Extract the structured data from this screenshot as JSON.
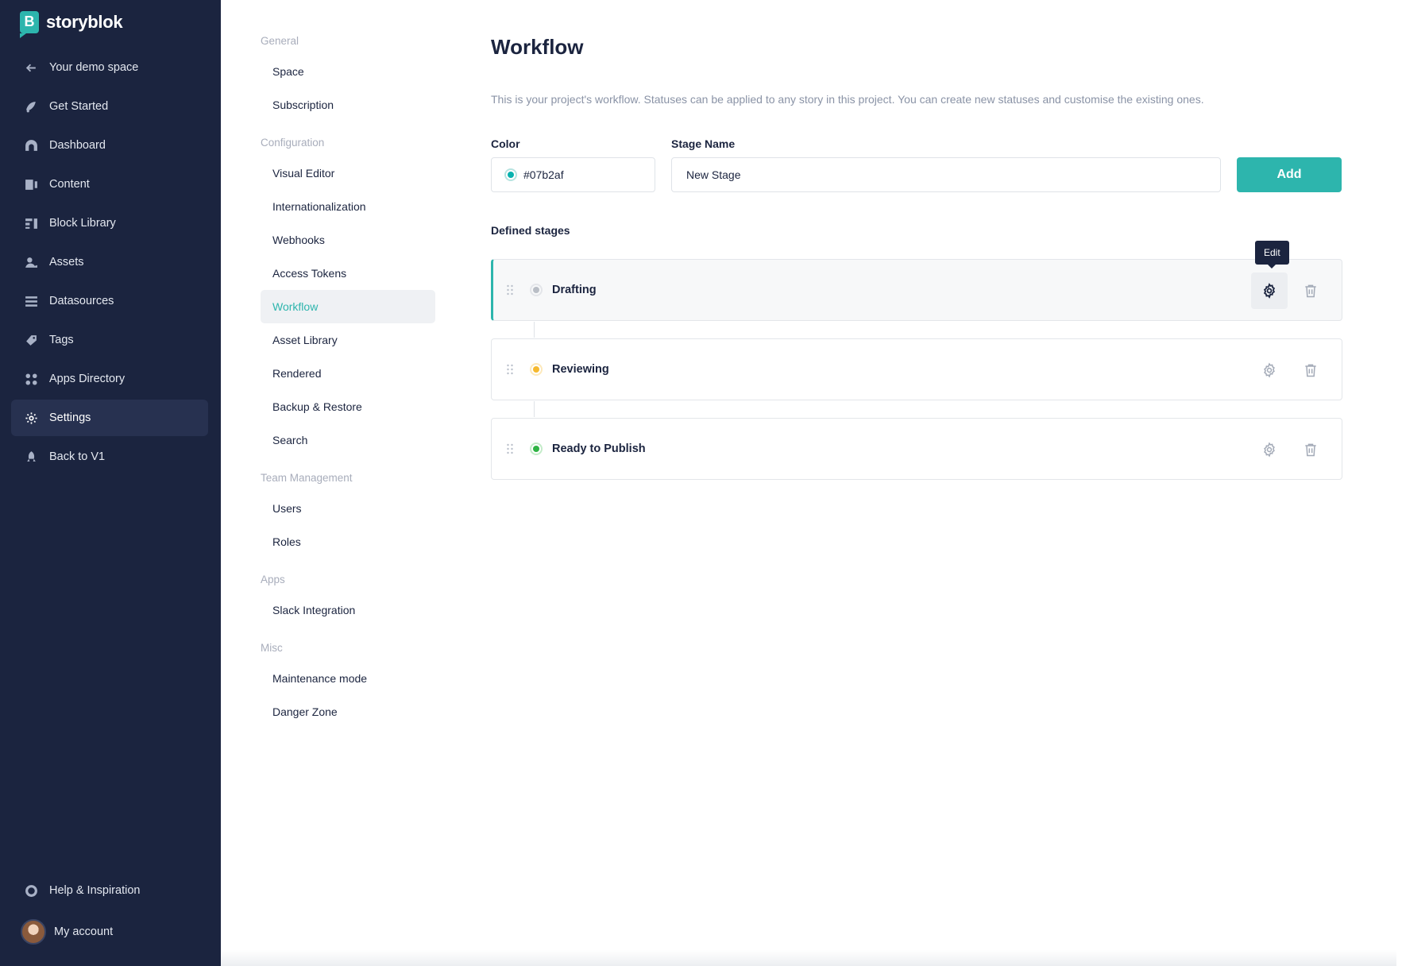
{
  "app": {
    "brand": "storyblok",
    "back_label": "Your demo space"
  },
  "sidebar": {
    "items": [
      {
        "label": "Get Started",
        "icon": "get-started-icon"
      },
      {
        "label": "Dashboard",
        "icon": "dashboard-icon"
      },
      {
        "label": "Content",
        "icon": "content-icon"
      },
      {
        "label": "Block Library",
        "icon": "block-library-icon"
      },
      {
        "label": "Assets",
        "icon": "assets-icon"
      },
      {
        "label": "Datasources",
        "icon": "datasources-icon"
      },
      {
        "label": "Tags",
        "icon": "tags-icon"
      },
      {
        "label": "Apps Directory",
        "icon": "apps-icon"
      },
      {
        "label": "Settings",
        "icon": "gear-icon",
        "active": true
      },
      {
        "label": "Back to V1",
        "icon": "rocket-icon"
      }
    ],
    "help_label": "Help & Inspiration",
    "account_label": "My account"
  },
  "submenu": {
    "general": {
      "heading": "General",
      "items": [
        "Space",
        "Subscription"
      ]
    },
    "configuration": {
      "heading": "Configuration",
      "items": [
        "Visual Editor",
        "Internationalization",
        "Webhooks",
        "Access Tokens",
        "Workflow",
        "Asset Library",
        "Rendered",
        "Backup & Restore",
        "Search"
      ]
    },
    "team": {
      "heading": "Team Management",
      "items": [
        "Users",
        "Roles"
      ]
    },
    "apps": {
      "heading": "Apps",
      "items": [
        "Slack Integration"
      ]
    },
    "misc": {
      "heading": "Misc",
      "items": [
        "Maintenance mode",
        "Danger Zone"
      ]
    },
    "active": "Workflow"
  },
  "main": {
    "title": "Workflow",
    "description": "This is your project's workflow. Statuses can be applied to any story in this project. You can create new statuses and customise the existing ones.",
    "color_label": "Color",
    "color_value": "#07b2af",
    "stage_name_label": "Stage Name",
    "stage_name_value": "New Stage",
    "add_label": "Add",
    "defined_stages_label": "Defined stages",
    "tooltip": "Edit",
    "stages": [
      {
        "name": "Drafting",
        "color": "#b9bec6"
      },
      {
        "name": "Reviewing",
        "color": "#f5b92f"
      },
      {
        "name": "Ready to Publish",
        "color": "#2fb344"
      }
    ]
  },
  "colors": {
    "accent": "#2db5ad",
    "sidebar_bg": "#1b243f"
  }
}
